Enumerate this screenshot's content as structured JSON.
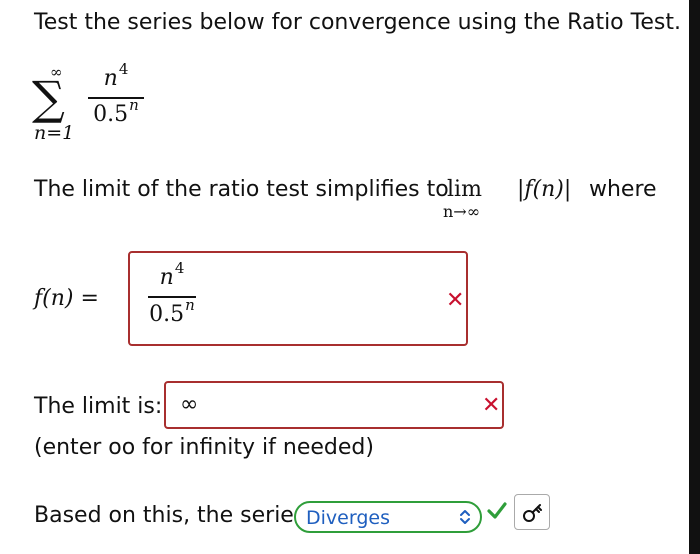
{
  "question": {
    "prompt": "Test the series below for convergence using the Ratio Test."
  },
  "series": {
    "sigma": "∑",
    "upper_limit": "∞",
    "lower_limit": "n=1",
    "term_numerator_base": "n",
    "term_numerator_exp": "4",
    "term_denominator_base": "0.5",
    "term_denominator_exp": "n"
  },
  "limit_statement": {
    "text": "The limit of the ratio test simplifies to",
    "lim_word": "lim",
    "lim_subscript": "n→∞",
    "abs_expression": "|f(n)|",
    "where": "where"
  },
  "fn_answer": {
    "label": "f(n) =",
    "numerator_base": "n",
    "numerator_exp": "4",
    "denominator_base": "0.5",
    "denominator_exp": "n",
    "status": "incorrect",
    "status_icon": "x-mark-icon",
    "status_glyph": "✕"
  },
  "limit_answer": {
    "label": "The limit is:",
    "value": "∞",
    "status": "incorrect",
    "status_icon": "x-mark-icon",
    "status_glyph": "✕"
  },
  "hint": {
    "text": "(enter oo for infinity if needed)"
  },
  "conclusion": {
    "label": "Based on this, the series",
    "selected": "Diverges",
    "status": "correct",
    "status_icon": "checkmark-icon",
    "key_icon": "key-icon"
  },
  "colors": {
    "incorrect_border": "#a82f2f",
    "incorrect_mark": "#c8102e",
    "correct_border": "#2f9e3a",
    "select_text": "#1f5fbf",
    "check": "#2f9e3a"
  }
}
